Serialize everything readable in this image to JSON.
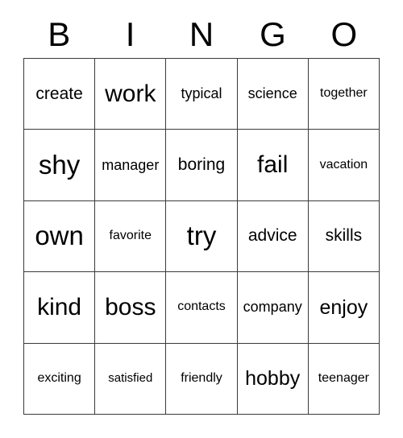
{
  "card": {
    "type": "bingo-card",
    "header_letters": [
      "B",
      "I",
      "N",
      "G",
      "O"
    ],
    "columns": 5,
    "rows": 5,
    "colors": {
      "background": "#ffffff",
      "text": "#000000",
      "grid_border": "#3a3a3a"
    },
    "rows_data": [
      {
        "cells": [
          {
            "word": "create"
          },
          {
            "word": "work"
          },
          {
            "word": "typical"
          },
          {
            "word": "science"
          },
          {
            "word": "together"
          }
        ]
      },
      {
        "cells": [
          {
            "word": "shy"
          },
          {
            "word": "manager"
          },
          {
            "word": "boring"
          },
          {
            "word": "fail"
          },
          {
            "word": "vacation"
          }
        ]
      },
      {
        "cells": [
          {
            "word": "own"
          },
          {
            "word": "favorite"
          },
          {
            "word": "try"
          },
          {
            "word": "advice"
          },
          {
            "word": "skills"
          }
        ]
      },
      {
        "cells": [
          {
            "word": "kind"
          },
          {
            "word": "boss"
          },
          {
            "word": "contacts"
          },
          {
            "word": "company"
          },
          {
            "word": "enjoy"
          }
        ]
      },
      {
        "cells": [
          {
            "word": "exciting"
          },
          {
            "word": "satisfied"
          },
          {
            "word": "friendly"
          },
          {
            "word": "hobby"
          },
          {
            "word": "teenager"
          }
        ]
      }
    ]
  }
}
